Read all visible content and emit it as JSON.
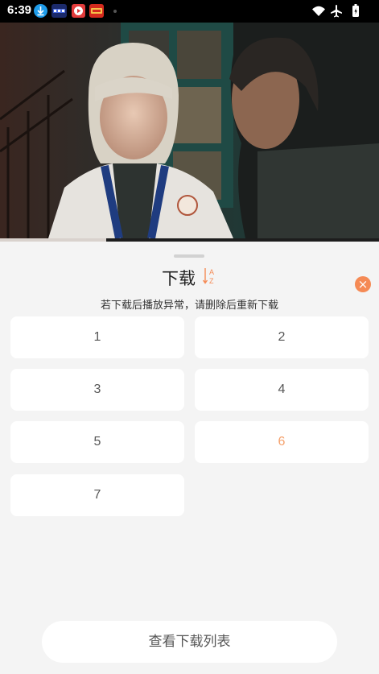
{
  "status_bar": {
    "time": "6:39",
    "app_icons": [
      "download-app-icon",
      "news-app-icon",
      "video-app-icon",
      "red-app-icon"
    ],
    "status_icons": [
      "wifi-icon",
      "airplane-icon",
      "battery-icon"
    ]
  },
  "video": {
    "progress_fraction": 0.28
  },
  "sheet": {
    "title": "下载",
    "sort_icon_letters": [
      "A",
      "Z"
    ],
    "notice": "若下载后播放异常，请删除后重新下载",
    "episodes": [
      {
        "label": "1",
        "active": false
      },
      {
        "label": "2",
        "active": false
      },
      {
        "label": "3",
        "active": false
      },
      {
        "label": "4",
        "active": false
      },
      {
        "label": "5",
        "active": false
      },
      {
        "label": "6",
        "active": true
      },
      {
        "label": "7",
        "active": false
      }
    ],
    "view_list_button": "查看下载列表"
  },
  "colors": {
    "accent": "#f58a55",
    "active_episode": "#f5a06b",
    "sheet_bg": "#f4f4f4",
    "card_bg": "#ffffff"
  }
}
